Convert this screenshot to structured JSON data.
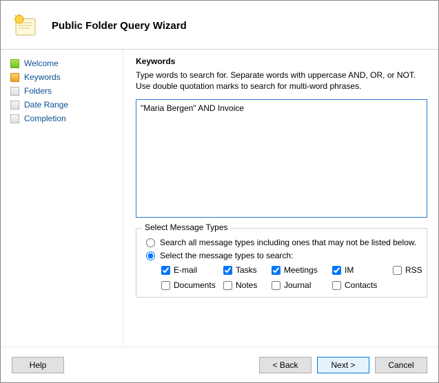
{
  "header": {
    "title": "Public Folder Query Wizard"
  },
  "sidebar": {
    "items": [
      {
        "label": "Welcome",
        "state": "done"
      },
      {
        "label": "Keywords",
        "state": "active"
      },
      {
        "label": "Folders",
        "state": "pending"
      },
      {
        "label": "Date Range",
        "state": "pending"
      },
      {
        "label": "Completion",
        "state": "pending"
      }
    ]
  },
  "main": {
    "heading": "Keywords",
    "instructions": "Type words to search for. Separate words with uppercase AND, OR, or NOT. Use double quotation marks to search for multi-word phrases.",
    "keywords_value": "\"Maria Bergen\" AND Invoice"
  },
  "message_types": {
    "legend": "Select Message Types",
    "radio_all": "Search all message types including ones that may not be listed below.",
    "radio_select": "Select the message types to search:",
    "selected_mode": "select",
    "types": [
      {
        "key": "email",
        "label": "E-mail",
        "checked": true
      },
      {
        "key": "tasks",
        "label": "Tasks",
        "checked": true
      },
      {
        "key": "meetings",
        "label": "Meetings",
        "checked": true
      },
      {
        "key": "im",
        "label": "IM",
        "checked": true
      },
      {
        "key": "rss",
        "label": "RSS",
        "checked": false
      },
      {
        "key": "documents",
        "label": "Documents",
        "checked": false
      },
      {
        "key": "notes",
        "label": "Notes",
        "checked": false
      },
      {
        "key": "journal",
        "label": "Journal",
        "checked": false
      },
      {
        "key": "contacts",
        "label": "Contacts",
        "checked": false
      }
    ]
  },
  "footer": {
    "help": "Help",
    "back": "< Back",
    "next": "Next >",
    "cancel": "Cancel"
  }
}
